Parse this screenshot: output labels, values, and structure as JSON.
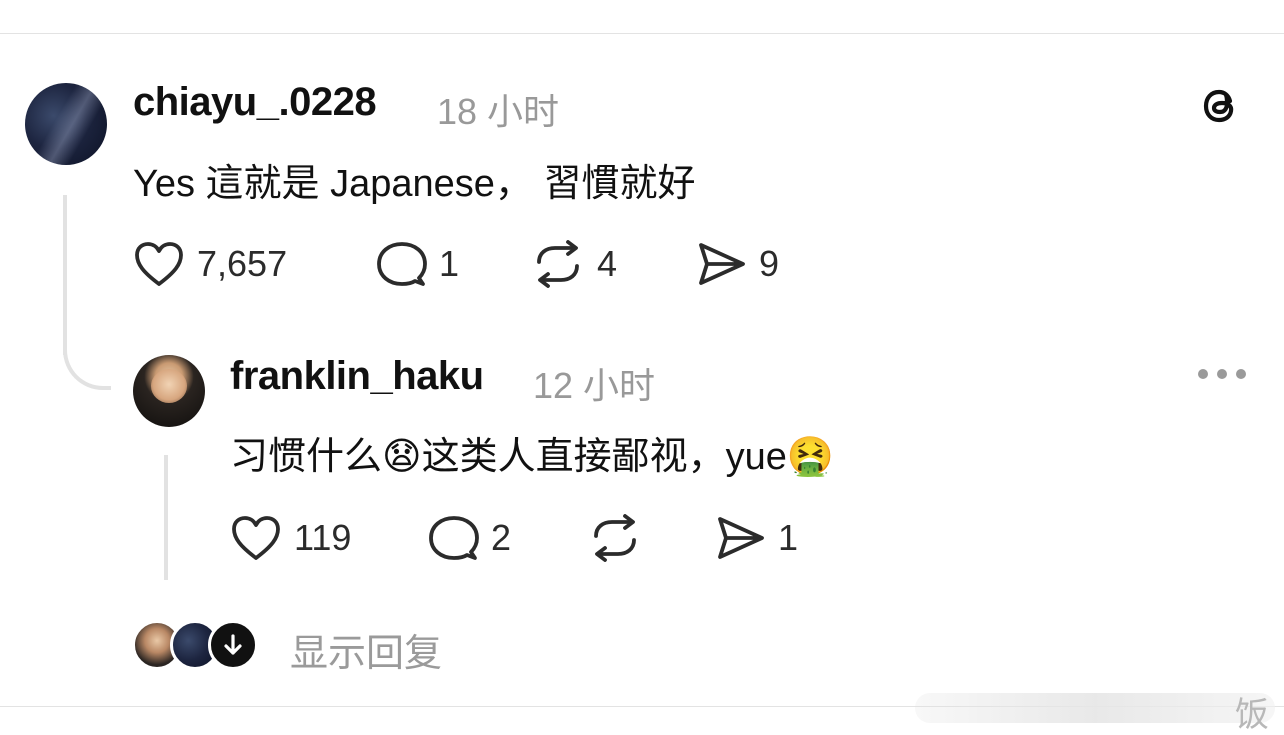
{
  "post": {
    "username": "chiayu_.0228",
    "time": "18 小时",
    "text": "Yes 這就是 Japanese，  習慣就好",
    "likes": "7,657",
    "comments": "1",
    "reposts": "4",
    "shares": "9"
  },
  "reply": {
    "username": "franklin_haku",
    "time": "12 小时",
    "text_part1": "习惯什么",
    "emoji1": "😧",
    "text_part2": "这类人直接鄙视，yue",
    "emoji2": "🤮",
    "likes": "119",
    "comments": "2",
    "shares": "1"
  },
  "show_replies_label": "显示回复",
  "watermark_text": "饭",
  "icons": {
    "like": "heart-icon",
    "comment": "comment-bubble-icon",
    "repost": "repost-icon",
    "share": "send-icon",
    "app": "threads-logo-icon",
    "more": "more-options-icon",
    "down": "arrow-down-icon"
  }
}
